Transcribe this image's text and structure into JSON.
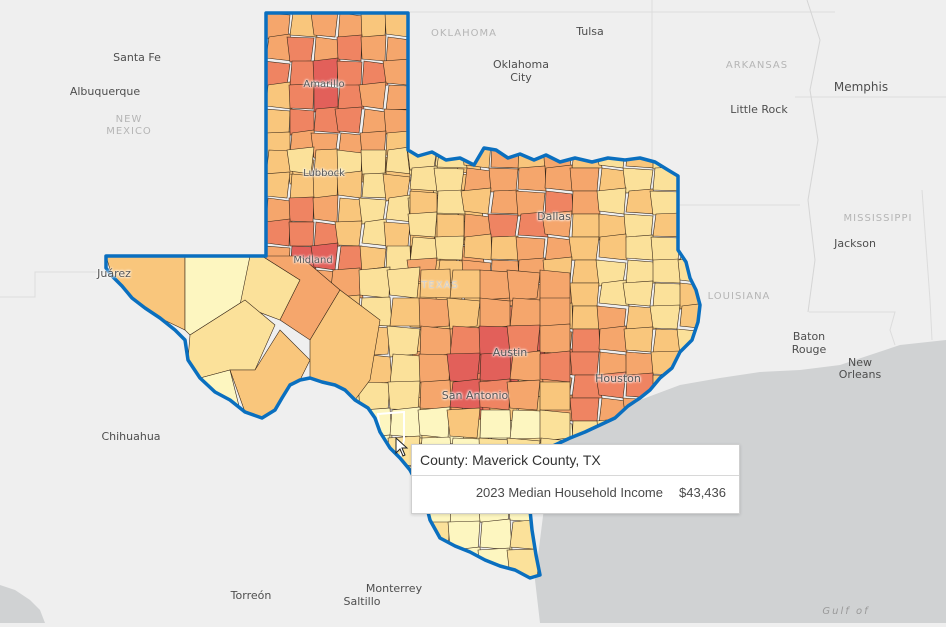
{
  "map": {
    "layer_title": "2023 Median Household Income",
    "focus_state": "TEXAS",
    "colors": {
      "background": "#efefef",
      "water": "#d0d2d3",
      "state_outline": "#0a6fbf",
      "county_border": "#3b2a1a",
      "class_1": "#fdf6c0",
      "class_2": "#fbe19a",
      "class_3": "#f9c67c",
      "class_4": "#f5a66c",
      "class_5": "#ef8462",
      "class_6": "#e2605a"
    },
    "state_labels": [
      {
        "text": "OKLAHOMA"
      },
      {
        "text": "ARKANSAS"
      },
      {
        "text": "NEW"
      },
      {
        "text": "MEXICO"
      },
      {
        "text": "MISSISSIPPI"
      },
      {
        "text": "LOUISIANA"
      },
      {
        "text": "TEXAS"
      }
    ],
    "city_labels": {
      "santa_fe": "Santa Fe",
      "albuquerque": "Albuquerque",
      "tulsa": "Tulsa",
      "oklahoma_city_1": "Oklahoma",
      "oklahoma_city_2": "City",
      "little_rock": "Little Rock",
      "memphis": "Memphis",
      "jackson": "Jackson",
      "baton_rouge_1": "Baton",
      "baton_rouge_2": "Rouge",
      "new_orleans_1": "New",
      "new_orleans_2": "Orleans",
      "juarez": "Juárez",
      "chihuahua": "Chihuahua",
      "torreon": "Torreón",
      "monterrey": "Monterrey",
      "saltillo": "Saltillo",
      "amarillo": "Amarillo",
      "lubbock": "Lubbock",
      "midland": "Midland",
      "dallas": "Dallas",
      "austin": "Austin",
      "san_antonio": "San Antonio",
      "houston": "Houston"
    },
    "water_labels": {
      "gulf": "Gulf of"
    }
  },
  "popup": {
    "title": "County: Maverick County, TX",
    "field_label": "2023 Median Household Income",
    "field_value": "$43,436"
  }
}
